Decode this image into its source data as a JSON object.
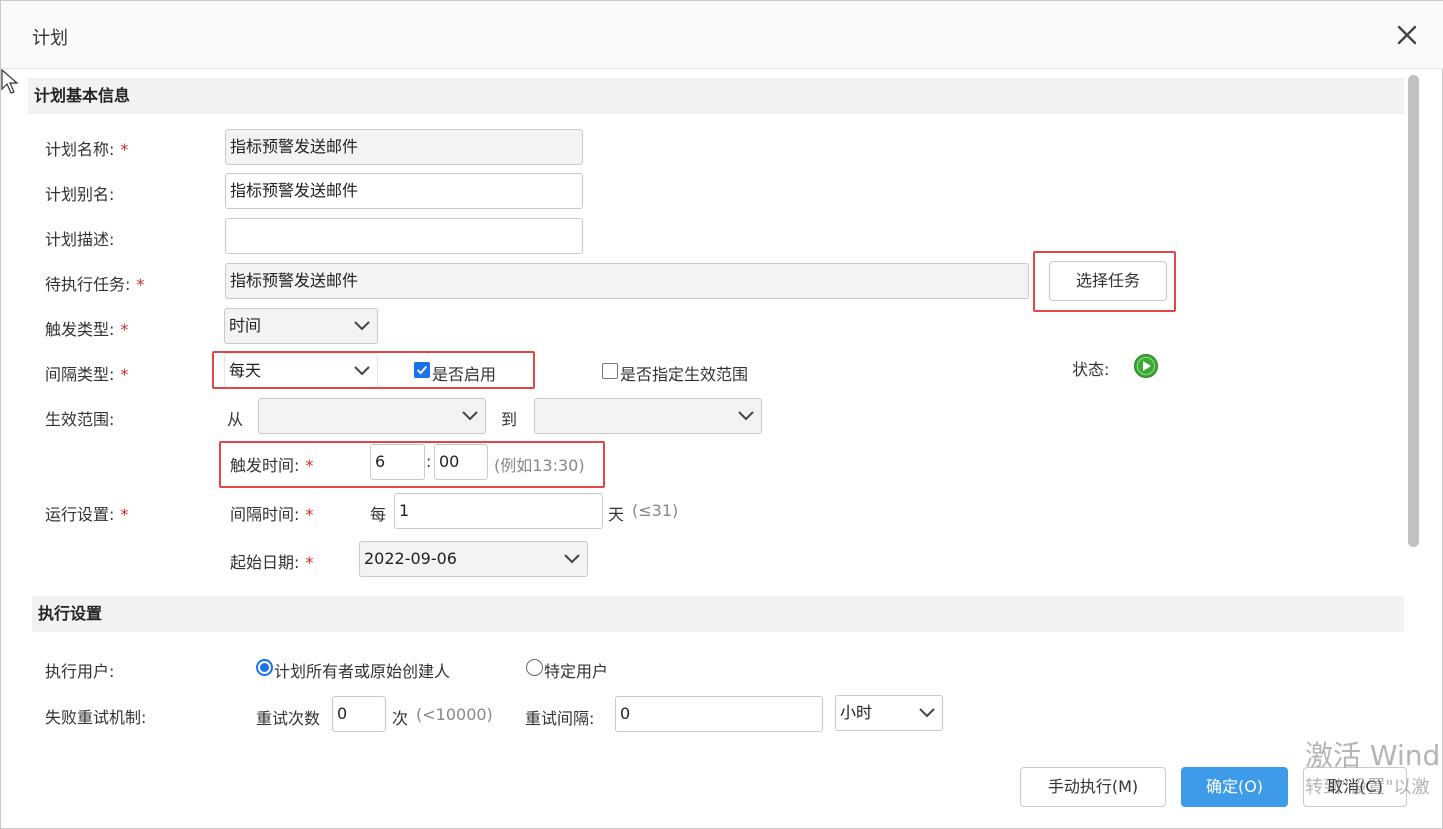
{
  "dialog": {
    "title": "计划"
  },
  "sections": {
    "basic": "计划基本信息",
    "execution": "执行设置"
  },
  "fields": {
    "plan_name": {
      "label": "计划名称:",
      "value": "指标预警发送邮件"
    },
    "plan_alias": {
      "label": "计划别名:",
      "value": "指标预警发送邮件"
    },
    "plan_desc": {
      "label": "计划描述:",
      "value": ""
    },
    "pending_task": {
      "label": "待执行任务:",
      "value": "指标预警发送邮件"
    },
    "trigger_type": {
      "label": "触发类型:",
      "value": "时间"
    },
    "interval_type": {
      "label": "间隔类型:",
      "value": "每天"
    },
    "enabled": {
      "label": "是否启用",
      "checked": true
    },
    "specify_range": {
      "label": "是否指定生效范围",
      "checked": false
    },
    "status": {
      "label": "状态:"
    },
    "effective_range": {
      "label": "生效范围:",
      "from": "从",
      "to": "到",
      "from_value": "",
      "to_value": ""
    },
    "trigger_time": {
      "label": "触发时间:",
      "hour": "6",
      "sep": ":",
      "minute": "00",
      "hint": "(例如13:30)"
    },
    "run_settings": {
      "label": "运行设置:"
    },
    "interval_time": {
      "label": "间隔时间:",
      "prefix": "每",
      "value": "1",
      "unit": "天",
      "hint": "(≤31)"
    },
    "start_date": {
      "label": "起始日期:",
      "value": "2022-09-06"
    },
    "exec_user": {
      "label": "执行用户:",
      "option1": "计划所有者或原始创建人",
      "option2": "特定用户",
      "selected": 1
    },
    "retry": {
      "label": "失败重试机制:",
      "count_label": "重试次数",
      "count": "0",
      "count_unit": "次",
      "count_hint": "(<10000)",
      "interval_label": "重试间隔:",
      "interval": "0",
      "interval_unit": "小时"
    }
  },
  "required_mark": "*",
  "buttons": {
    "select_task": "选择任务",
    "manual_run": "手动执行(M)",
    "ok": "确定(O)",
    "cancel": "取消(C)"
  },
  "watermark": {
    "line1": "激活 Wind",
    "line2": "转到\"设置\"以激"
  },
  "colors": {
    "primary": "#3d9be9",
    "required": "#e02424",
    "highlight": "#e04848",
    "status_green": "#3aa935"
  }
}
